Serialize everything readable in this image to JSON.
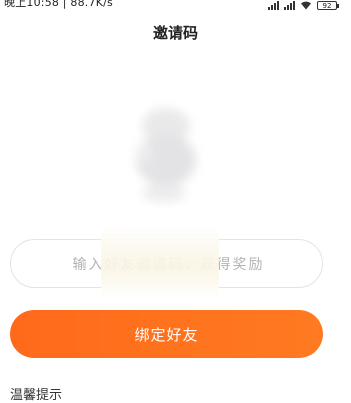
{
  "status_bar": {
    "time_speed": "晚上10:58 | 88.7K/s",
    "battery": "92"
  },
  "header": {
    "title": "邀请码"
  },
  "invite": {
    "placeholder": "输入好友邀请码，获得奖励",
    "bind_button": "绑定好友"
  },
  "tips": {
    "title": "温馨提示"
  },
  "colors": {
    "accent": "#ff6d1c",
    "input_border": "#e4e4e4",
    "placeholder": "#b3b3b3"
  },
  "icons": {
    "illustration": "blurred-mascot-illustration"
  }
}
